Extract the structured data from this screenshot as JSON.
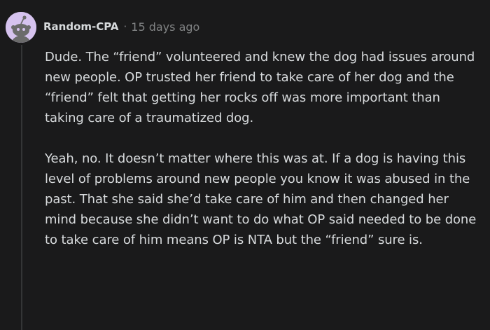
{
  "comment": {
    "author": "Random-CPA",
    "separator": "·",
    "timestamp": "15 days ago",
    "avatar_icon": "reddit-snoo-avatar-icon",
    "paragraphs": [
      "Dude. The “friend” volunteered and knew the dog had issues around new people. OP trusted her friend to take care of her dog and the “friend” felt that getting her rocks off was more important than taking care of a traumatized dog.",
      "Yeah, no. It doesn’t matter where this was at. If a dog is having this level of problems around new people you know it was abused in the past. That she said she’d take care of him and then changed her mind because she didn’t want to do what OP said needed to be done to take care of him means OP is NTA but the “friend” sure is."
    ]
  },
  "colors": {
    "background": "#1a1a1b",
    "text": "#d7dadc",
    "muted": "#818384",
    "thread_line": "#343536",
    "avatar_bg": "#d6c3ef"
  }
}
